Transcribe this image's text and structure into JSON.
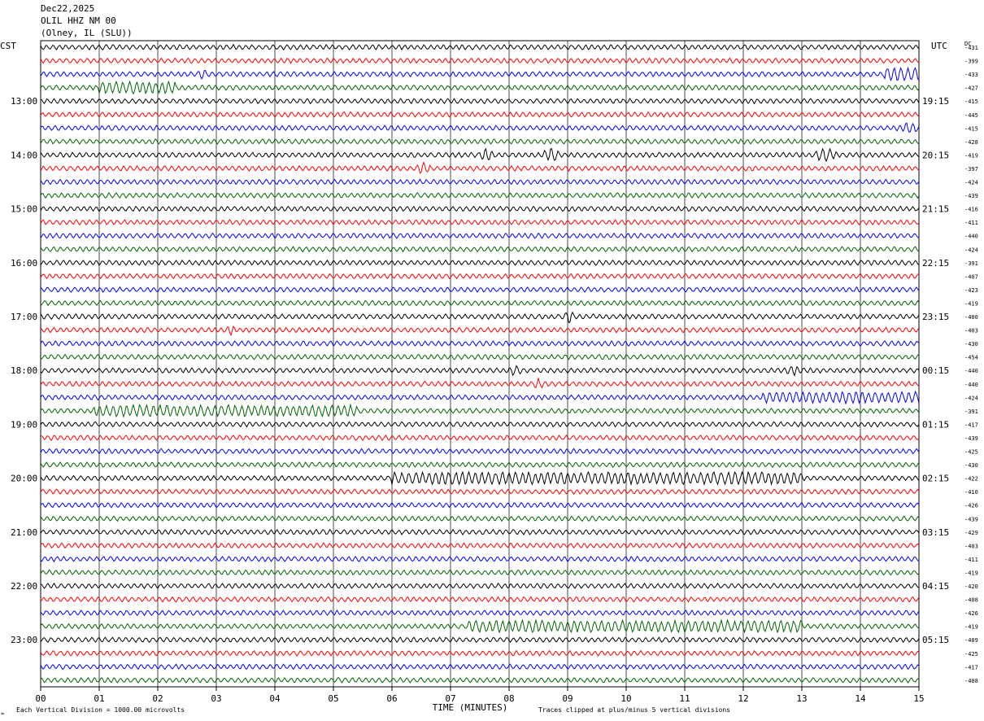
{
  "header": {
    "date": "Dec22,2025",
    "station": "OLIL HHZ NM 00",
    "location": "(Olney, IL (SLU))"
  },
  "axes_labels": {
    "left_tz": "CST",
    "right_tz": "UTC",
    "dc_label": "DC",
    "xlabel": "TIME (MINUTES)",
    "footer_left": "Each Vertical Division = 1000.00 microvolts",
    "footer_right": "Traces clipped at plus/minus 5 vertical divisions",
    "corner_mark": "≈"
  },
  "chart_data": {
    "type": "line",
    "title": "",
    "xlabel": "TIME (MINUTES)",
    "xlim": [
      0,
      15
    ],
    "x_ticks": [
      "00",
      "01",
      "02",
      "03",
      "04",
      "05",
      "06",
      "07",
      "08",
      "09",
      "10",
      "11",
      "12",
      "13",
      "14",
      "15"
    ],
    "row_minutes": 15,
    "trace_colors": [
      "#000000",
      "#ff0000",
      "#0000ff",
      "#006400"
    ],
    "left_hour_labels": [
      "13:00",
      "14:00",
      "15:00",
      "16:00",
      "17:00",
      "18:00",
      "19:00",
      "20:00",
      "21:00",
      "22:00",
      "23:00"
    ],
    "right_hour_labels": [
      "19:15",
      "20:15",
      "21:15",
      "22:15",
      "23:15",
      "00:15",
      "01:15",
      "02:15",
      "03:15",
      "04:15",
      "05:15"
    ],
    "dc_offsets": [
      "-431",
      "-399",
      "-433",
      "-427",
      "-415",
      "-445",
      "-415",
      "-428",
      "-419",
      "-397",
      "-424",
      "-439",
      "-416",
      "-411",
      "-440",
      "-424",
      "-391",
      "-407",
      "-423",
      "-419",
      "-400",
      "-403",
      "-430",
      "-454",
      "-440",
      "-440",
      "-424",
      "-391",
      "-417",
      "-439",
      "-425",
      "-430",
      "-422",
      "-410",
      "-426",
      "-439",
      "-429",
      "-403",
      "-411",
      "-419",
      "-420",
      "-408",
      "-426",
      "-419",
      "-409",
      "-425",
      "-417",
      "-408"
    ],
    "events": [
      {
        "row": 2,
        "x": 2.7,
        "width": 0.15,
        "amp": 2.0
      },
      {
        "row": 2,
        "x": 14.4,
        "width": 0.8,
        "amp": 2.2
      },
      {
        "row": 3,
        "x": 1.0,
        "width": 1.3,
        "amp": 1.6
      },
      {
        "row": 6,
        "x": 14.6,
        "width": 0.5,
        "amp": 1.6
      },
      {
        "row": 8,
        "x": 7.5,
        "width": 0.25,
        "amp": 2.6
      },
      {
        "row": 8,
        "x": 8.6,
        "width": 0.25,
        "amp": 3.4
      },
      {
        "row": 8,
        "x": 13.2,
        "width": 0.4,
        "amp": 2.6
      },
      {
        "row": 9,
        "x": 6.4,
        "width": 0.25,
        "amp": 2.0
      },
      {
        "row": 20,
        "x": 8.95,
        "width": 0.15,
        "amp": 3.0
      },
      {
        "row": 21,
        "x": 3.15,
        "width": 0.2,
        "amp": 1.8
      },
      {
        "row": 24,
        "x": 8.0,
        "width": 0.2,
        "amp": 1.5
      },
      {
        "row": 24,
        "x": 12.7,
        "width": 0.3,
        "amp": 1.4
      },
      {
        "row": 25,
        "x": 8.4,
        "width": 0.2,
        "amp": 1.6
      },
      {
        "row": 26,
        "x": 12.3,
        "width": 2.7,
        "amp": 1.4
      },
      {
        "row": 27,
        "x": 0.9,
        "width": 4.5,
        "amp": 1.4
      },
      {
        "row": 32,
        "x": 6.0,
        "width": 7.0,
        "amp": 1.6
      },
      {
        "row": 43,
        "x": 7.3,
        "width": 5.7,
        "amp": 1.5
      }
    ]
  }
}
